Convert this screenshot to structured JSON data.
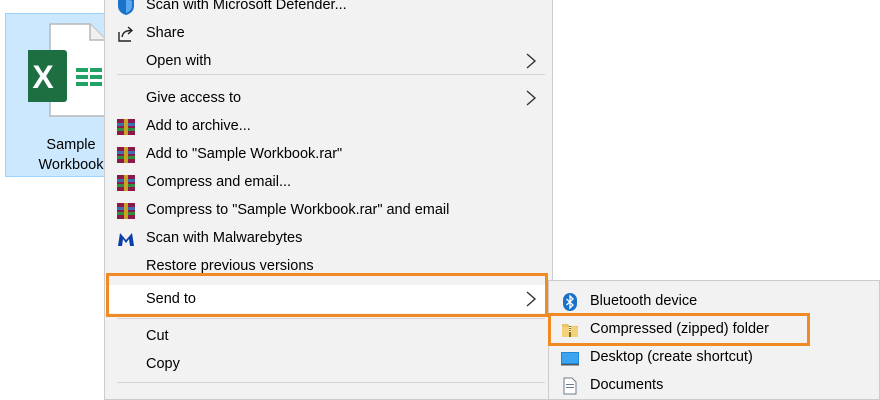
{
  "desktop_file": {
    "name_line1": "Sample",
    "name_line2": "Workbook",
    "icon": "excel-file-icon"
  },
  "context_menu": {
    "items": [
      {
        "label": "Scan with Microsoft Defender...",
        "icon": "defender-shield-icon"
      },
      {
        "label": "Share",
        "icon": "share-icon"
      },
      {
        "label": "Open with",
        "icon": "",
        "submenu": true
      },
      {
        "label": "Give access to",
        "icon": "",
        "submenu": true
      },
      {
        "label": "Add to archive...",
        "icon": "winrar-icon"
      },
      {
        "label": "Add to \"Sample Workbook.rar\"",
        "icon": "winrar-icon"
      },
      {
        "label": "Compress and email...",
        "icon": "winrar-icon"
      },
      {
        "label": "Compress to \"Sample Workbook.rar\" and email",
        "icon": "winrar-icon"
      },
      {
        "label": "Scan with Malwarebytes",
        "icon": "malwarebytes-icon"
      },
      {
        "label": "Restore previous versions",
        "icon": ""
      },
      {
        "label": "Send to",
        "icon": "",
        "submenu": true
      },
      {
        "label": "Cut",
        "icon": ""
      },
      {
        "label": "Copy",
        "icon": ""
      }
    ]
  },
  "send_to_submenu": {
    "items": [
      {
        "label": "Bluetooth device",
        "icon": "bluetooth-icon"
      },
      {
        "label": "Compressed (zipped) folder",
        "icon": "zip-folder-icon"
      },
      {
        "label": "Desktop (create shortcut)",
        "icon": "desktop-icon"
      },
      {
        "label": "Documents",
        "icon": "documents-icon"
      }
    ]
  },
  "colors": {
    "highlight": "#f08a24",
    "menu_bg": "#f2f2f2",
    "selection_bg": "#cce8ff",
    "excel_green": "#1d6f42"
  }
}
